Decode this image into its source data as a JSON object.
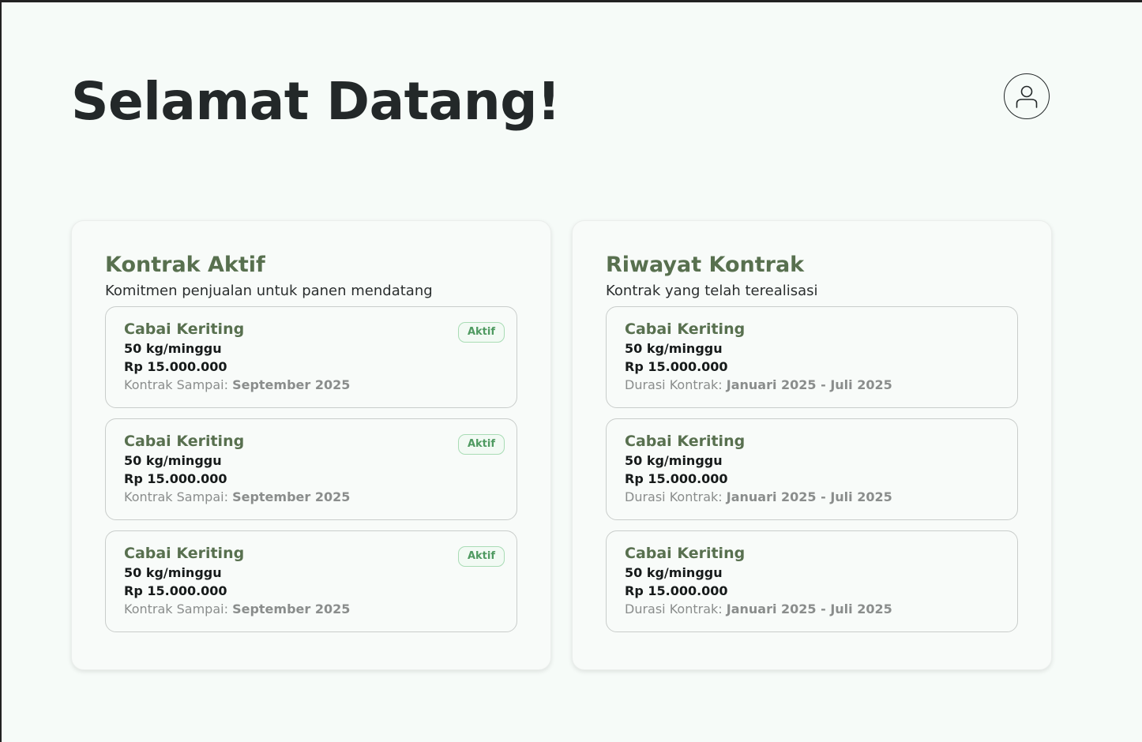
{
  "header": {
    "title": "Selamat Datang!",
    "avatar_icon": "user-icon"
  },
  "colors": {
    "background": "#f6fbf8",
    "accent_green": "#58704f",
    "badge_green": "#4f9a61"
  },
  "active_contracts": {
    "title": "Kontrak Aktif",
    "subtitle": "Komitmen penjualan untuk panen mendatang",
    "items": [
      {
        "name": "Cabai Keriting",
        "quantity": "50 kg/minggu",
        "price": "Rp 15.000.000",
        "meta_label": "Kontrak Sampai:",
        "meta_value": "September 2025",
        "badge": "Aktif"
      },
      {
        "name": "Cabai Keriting",
        "quantity": "50 kg/minggu",
        "price": "Rp 15.000.000",
        "meta_label": "Kontrak Sampai:",
        "meta_value": "September 2025",
        "badge": "Aktif"
      },
      {
        "name": "Cabai Keriting",
        "quantity": "50 kg/minggu",
        "price": "Rp 15.000.000",
        "meta_label": "Kontrak Sampai:",
        "meta_value": "September 2025",
        "badge": "Aktif"
      }
    ]
  },
  "contract_history": {
    "title": "Riwayat Kontrak",
    "subtitle": "Kontrak yang telah terealisasi",
    "items": [
      {
        "name": "Cabai Keriting",
        "quantity": "50 kg/minggu",
        "price": "Rp 15.000.000",
        "meta_label": "Durasi Kontrak:",
        "meta_value": "Januari 2025 - Juli 2025"
      },
      {
        "name": "Cabai Keriting",
        "quantity": "50 kg/minggu",
        "price": "Rp 15.000.000",
        "meta_label": "Durasi Kontrak:",
        "meta_value": "Januari 2025 - Juli 2025"
      },
      {
        "name": "Cabai Keriting",
        "quantity": "50 kg/minggu",
        "price": "Rp 15.000.000",
        "meta_label": "Durasi Kontrak:",
        "meta_value": "Januari 2025 - Juli 2025"
      }
    ]
  }
}
